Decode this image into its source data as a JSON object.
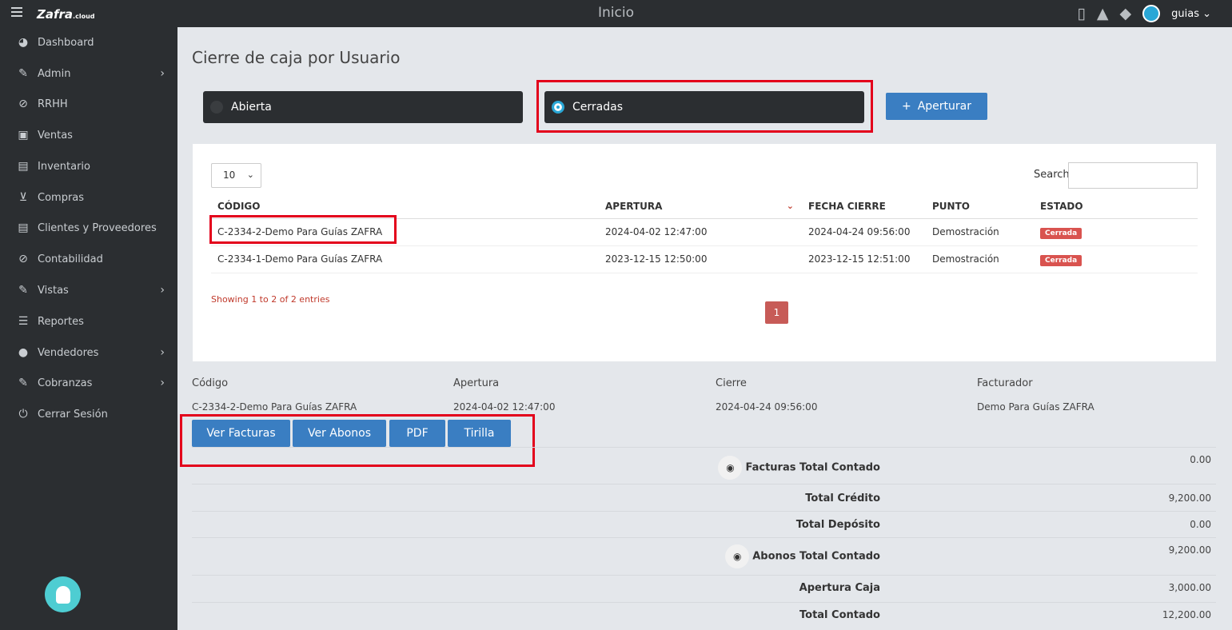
{
  "app": {
    "logo": "Zafra",
    "logo_suffix": ".cloud",
    "page_title": "Inicio",
    "user": "guias"
  },
  "sidebar": {
    "items": [
      {
        "label": "Dashboard",
        "icon": "dashboard-icon",
        "has_children": false
      },
      {
        "label": "Admin",
        "icon": "wrench-icon",
        "has_children": true
      },
      {
        "label": "RRHH",
        "icon": "paperclip-icon",
        "has_children": false
      },
      {
        "label": "Ventas",
        "icon": "money-icon",
        "has_children": false
      },
      {
        "label": "Inventario",
        "icon": "book-icon",
        "has_children": false
      },
      {
        "label": "Compras",
        "icon": "cart-icon",
        "has_children": false
      },
      {
        "label": "Clientes y Proveedores",
        "icon": "book-icon",
        "has_children": false
      },
      {
        "label": "Contabilidad",
        "icon": "paperclip-icon",
        "has_children": false
      },
      {
        "label": "Vistas",
        "icon": "edit-icon",
        "has_children": true
      },
      {
        "label": "Reportes",
        "icon": "list-icon",
        "has_children": false
      },
      {
        "label": "Vendedores",
        "icon": "user-icon",
        "has_children": true
      },
      {
        "label": "Cobranzas",
        "icon": "edit-icon",
        "has_children": true
      },
      {
        "label": "Cerrar Sesión",
        "icon": "power-icon",
        "has_children": false
      }
    ]
  },
  "page": {
    "heading": "Cierre de caja por Usuario",
    "tab_open": "Abierta",
    "tab_closed": "Cerradas",
    "selected_tab": "Cerradas",
    "btn_open": "Aperturar"
  },
  "table": {
    "page_length": "10",
    "search_label": "Search:",
    "search_value": "",
    "columns": [
      "CÓDIGO",
      "APERTURA",
      "FECHA CIERRE",
      "PUNTO",
      "ESTADO"
    ],
    "rows": [
      {
        "codigo": "C-2334-2-Demo Para Guías ZAFRA",
        "apertura": "2024-04-02 12:47:00",
        "cierre": "2024-04-24 09:56:00",
        "punto": "Demostración",
        "estado": "Cerrada"
      },
      {
        "codigo": "C-2334-1-Demo Para Guías ZAFRA",
        "apertura": "2023-12-15 12:50:00",
        "cierre": "2023-12-15 12:51:00",
        "punto": "Demostración",
        "estado": "Cerrada"
      }
    ],
    "info": "Showing 1 to 2 of 2 entries",
    "current_page": "1"
  },
  "detail": {
    "labels": {
      "codigo": "Código",
      "apertura": "Apertura",
      "cierre": "Cierre",
      "facturador": "Facturador"
    },
    "values": {
      "codigo": "C-2334-2-Demo Para Guías ZAFRA",
      "apertura": "2024-04-02 12:47:00",
      "cierre": "2024-04-24 09:56:00",
      "facturador": "Demo Para Guías ZAFRA"
    },
    "buttons": {
      "facturas": "Ver Facturas",
      "abonos": "Ver Abonos",
      "pdf": "PDF",
      "tirilla": "Tirilla"
    }
  },
  "totals": [
    {
      "label": "Facturas Total Contado",
      "value": "0.00",
      "has_eye": true
    },
    {
      "label": "Total Crédito",
      "value": "9,200.00",
      "has_eye": false
    },
    {
      "label": "Total Depósito",
      "value": "0.00",
      "has_eye": false
    },
    {
      "label": "Abonos Total Contado",
      "value": "9,200.00",
      "has_eye": true
    },
    {
      "label": "Apertura Caja",
      "value": "3,000.00",
      "has_eye": false
    },
    {
      "label": "Total Contado",
      "value": "12,200.00",
      "has_eye": false
    }
  ],
  "colors": {
    "accent": "#3a7ec2",
    "highlight": "#e3001b",
    "sidebar": "#2b2e31",
    "badge": "#d9534f"
  }
}
